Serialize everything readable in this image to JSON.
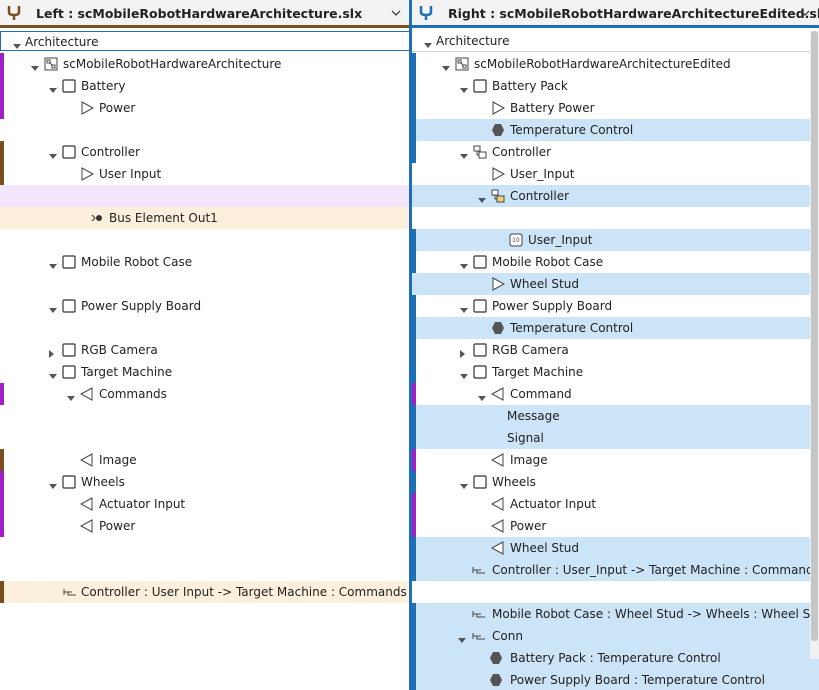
{
  "left": {
    "title": "Left : scMobileRobotHardwareArchitecture.slx",
    "column_header": "Architecture",
    "rows": [
      {
        "label": "scMobileRobotHardwareArchitecture",
        "icon": "model-icon"
      },
      {
        "label": "Battery",
        "icon": "component-icon"
      },
      {
        "label": "Power",
        "icon": "port-out-icon"
      },
      {
        "label": "Controller",
        "icon": "component-icon"
      },
      {
        "label": "User Input",
        "icon": "port-out-icon"
      },
      {
        "label": "Bus Element Out1",
        "icon": "bus-element-icon"
      },
      {
        "label": "Mobile Robot Case",
        "icon": "component-icon"
      },
      {
        "label": "Power Supply Board",
        "icon": "component-icon"
      },
      {
        "label": "RGB Camera",
        "icon": "component-icon"
      },
      {
        "label": "Target Machine",
        "icon": "component-icon"
      },
      {
        "label": "Commands",
        "icon": "port-in-icon"
      },
      {
        "label": "Image",
        "icon": "port-in-icon"
      },
      {
        "label": "Wheels",
        "icon": "component-icon"
      },
      {
        "label": "Actuator Input",
        "icon": "port-in-icon"
      },
      {
        "label": "Power",
        "icon": "port-in-icon"
      },
      {
        "label": "Controller : User Input -> Target Machine : Commands",
        "icon": "connector-icon"
      }
    ]
  },
  "right": {
    "title": "Right : scMobileRobotHardwareArchitectureEdited.slx",
    "column_header": "Architecture",
    "rows": [
      {
        "label": "scMobileRobotHardwareArchitectureEdited",
        "icon": "model-icon"
      },
      {
        "label": "Battery Pack",
        "icon": "component-icon"
      },
      {
        "label": "Battery Power",
        "icon": "port-out-icon"
      },
      {
        "label": "Temperature Control",
        "icon": "physical-port-icon"
      },
      {
        "label": "Controller",
        "icon": "variant-component-icon"
      },
      {
        "label": "User_Input",
        "icon": "port-out-icon"
      },
      {
        "label": "Controller",
        "icon": "variant-choice-icon"
      },
      {
        "label": "User_Input",
        "icon": "reference-port-icon"
      },
      {
        "label": "Mobile Robot Case",
        "icon": "component-icon"
      },
      {
        "label": "Wheel Stud",
        "icon": "port-out-icon"
      },
      {
        "label": "Power Supply Board",
        "icon": "component-icon"
      },
      {
        "label": "Temperature Control",
        "icon": "physical-port-icon"
      },
      {
        "label": "RGB Camera",
        "icon": "component-icon"
      },
      {
        "label": "Target Machine",
        "icon": "component-icon"
      },
      {
        "label": "Command",
        "icon": "port-in-icon"
      },
      {
        "label": "Message",
        "icon": ""
      },
      {
        "label": "Signal",
        "icon": ""
      },
      {
        "label": "Image",
        "icon": "port-in-icon"
      },
      {
        "label": "Wheels",
        "icon": "component-icon"
      },
      {
        "label": "Actuator Input",
        "icon": "port-in-icon"
      },
      {
        "label": "Power",
        "icon": "port-in-icon"
      },
      {
        "label": "Wheel Stud",
        "icon": "port-in-icon"
      },
      {
        "label": "Controller : User_Input -> Target Machine : Command",
        "icon": "connector-icon"
      },
      {
        "label": "Mobile Robot Case : Wheel Stud -> Wheels : Wheel Stud",
        "icon": "connector-icon"
      },
      {
        "label": "Conn",
        "icon": "connector-icon"
      },
      {
        "label": "Battery Pack : Temperature Control",
        "icon": "physical-port-icon"
      },
      {
        "label": "Power Supply Board : Temperature Control",
        "icon": "physical-port-icon"
      }
    ]
  },
  "colors": {
    "modified_highlight": "#cce4f7",
    "deleted_highlight": "#f3e6fb",
    "inserted_highlight": "#fcf0dd",
    "marker_purple": "#a020c8",
    "marker_brown": "#7a4f1f",
    "marker_blue": "#1f6fb5"
  }
}
